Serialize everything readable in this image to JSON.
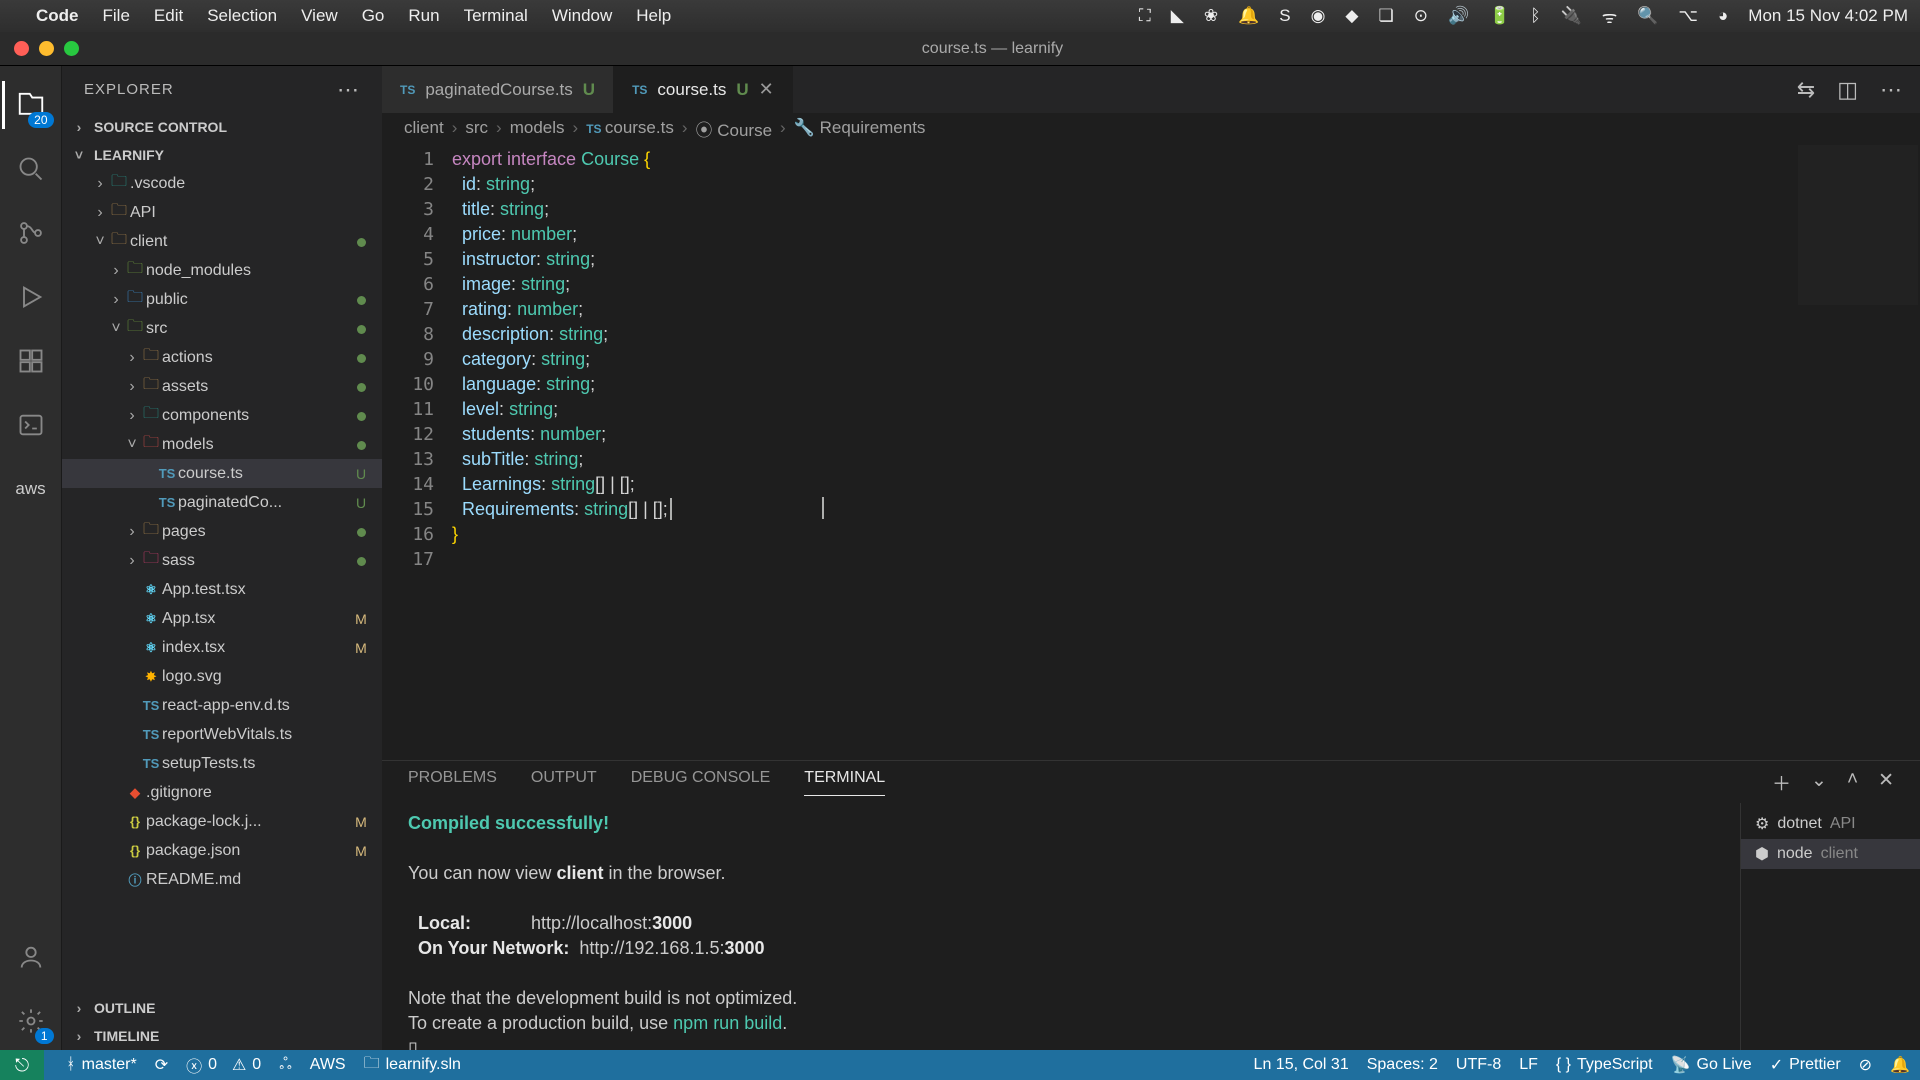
{
  "mac": {
    "app": "Code",
    "menus": [
      "File",
      "Edit",
      "Selection",
      "View",
      "Go",
      "Run",
      "Terminal",
      "Window",
      "Help"
    ],
    "clock": "Mon 15 Nov  4:02 PM"
  },
  "window": {
    "title": "course.ts — learnify"
  },
  "activity": {
    "badge_explorer": "20",
    "badge_settings": "1",
    "aws": "aws"
  },
  "explorer": {
    "title": "EXPLORER",
    "sections": {
      "source_control": "SOURCE CONTROL",
      "project": "LEARNIFY",
      "outline": "OUTLINE",
      "timeline": "TIMELINE"
    },
    "tree": [
      {
        "d": 2,
        "t": "folder",
        "icon": "folder-teal",
        "name": ".vscode",
        "chev": "›"
      },
      {
        "d": 2,
        "t": "folder",
        "icon": "folder-ico",
        "name": "API",
        "chev": "›"
      },
      {
        "d": 2,
        "t": "folder",
        "icon": "folder-ico",
        "name": "client",
        "chev": "˅",
        "dot": true
      },
      {
        "d": 3,
        "t": "folder",
        "icon": "folder-green",
        "name": "node_modules",
        "chev": "›"
      },
      {
        "d": 3,
        "t": "folder",
        "icon": "folder-blue",
        "name": "public",
        "chev": "›",
        "dot": true
      },
      {
        "d": 3,
        "t": "folder",
        "icon": "folder-green",
        "name": "src",
        "chev": "˅",
        "dot": true
      },
      {
        "d": 4,
        "t": "folder",
        "icon": "folder-ico",
        "name": "actions",
        "chev": "›",
        "dot": true
      },
      {
        "d": 4,
        "t": "folder",
        "icon": "folder-ico",
        "name": "assets",
        "chev": "›",
        "dot": true
      },
      {
        "d": 4,
        "t": "folder",
        "icon": "folder-teal",
        "name": "components",
        "chev": "›",
        "dot": true
      },
      {
        "d": 4,
        "t": "folder",
        "icon": "folder-red",
        "name": "models",
        "chev": "˅",
        "dot": true
      },
      {
        "d": 5,
        "t": "file",
        "icon": "ts-ico",
        "name": "course.ts",
        "status": "U",
        "sel": true
      },
      {
        "d": 5,
        "t": "file",
        "icon": "ts-ico",
        "name": "paginatedCo...",
        "status": "U"
      },
      {
        "d": 4,
        "t": "folder",
        "icon": "folder-ico",
        "name": "pages",
        "chev": "›",
        "dot": true
      },
      {
        "d": 4,
        "t": "folder",
        "icon": "folder-pink",
        "name": "sass",
        "chev": "›",
        "dot": true
      },
      {
        "d": 4,
        "t": "file",
        "icon": "react-ico",
        "name": "App.test.tsx"
      },
      {
        "d": 4,
        "t": "file",
        "icon": "react-ico",
        "name": "App.tsx",
        "status": "M"
      },
      {
        "d": 4,
        "t": "file",
        "icon": "react-ico",
        "name": "index.tsx",
        "status": "M"
      },
      {
        "d": 4,
        "t": "file",
        "icon": "svg-ico",
        "name": "logo.svg"
      },
      {
        "d": 4,
        "t": "file",
        "icon": "ts-ico",
        "name": "react-app-env.d.ts"
      },
      {
        "d": 4,
        "t": "file",
        "icon": "ts-ico",
        "name": "reportWebVitals.ts"
      },
      {
        "d": 4,
        "t": "file",
        "icon": "ts-ico",
        "name": "setupTests.ts"
      },
      {
        "d": 3,
        "t": "file",
        "icon": "git-ico",
        "name": ".gitignore"
      },
      {
        "d": 3,
        "t": "file",
        "icon": "json-ico",
        "name": "package-lock.j...",
        "status": "M"
      },
      {
        "d": 3,
        "t": "file",
        "icon": "json-ico",
        "name": "package.json",
        "status": "M"
      },
      {
        "d": 3,
        "t": "file",
        "icon": "md-ico",
        "name": "README.md"
      }
    ]
  },
  "tabs": [
    {
      "name": "paginatedCourse.ts",
      "mod": "U",
      "active": false
    },
    {
      "name": "course.ts",
      "mod": "U",
      "active": true
    }
  ],
  "breadcrumb": [
    "client",
    "src",
    "models",
    "course.ts",
    "Course",
    "Requirements"
  ],
  "code": {
    "lines": 17,
    "src": [
      {
        "n": 1,
        "t": [
          [
            "kw",
            "export "
          ],
          [
            "kw",
            "interface "
          ],
          [
            "typename",
            "Course "
          ],
          [
            "brace",
            "{"
          ]
        ]
      },
      {
        "n": 2,
        "t": [
          [
            "punc",
            "  "
          ],
          [
            "ident",
            "id"
          ],
          [
            "punc",
            ": "
          ],
          [
            "type",
            "string"
          ],
          [
            "punc",
            ";"
          ]
        ]
      },
      {
        "n": 3,
        "t": [
          [
            "punc",
            "  "
          ],
          [
            "ident",
            "title"
          ],
          [
            "punc",
            ": "
          ],
          [
            "type",
            "string"
          ],
          [
            "punc",
            ";"
          ]
        ]
      },
      {
        "n": 4,
        "t": [
          [
            "punc",
            "  "
          ],
          [
            "ident",
            "price"
          ],
          [
            "punc",
            ": "
          ],
          [
            "type",
            "number"
          ],
          [
            "punc",
            ";"
          ]
        ]
      },
      {
        "n": 5,
        "t": [
          [
            "punc",
            "  "
          ],
          [
            "ident",
            "instructor"
          ],
          [
            "punc",
            ": "
          ],
          [
            "type",
            "string"
          ],
          [
            "punc",
            ";"
          ]
        ]
      },
      {
        "n": 6,
        "t": [
          [
            "punc",
            "  "
          ],
          [
            "ident",
            "image"
          ],
          [
            "punc",
            ": "
          ],
          [
            "type",
            "string"
          ],
          [
            "punc",
            ";"
          ]
        ]
      },
      {
        "n": 7,
        "t": [
          [
            "punc",
            "  "
          ],
          [
            "ident",
            "rating"
          ],
          [
            "punc",
            ": "
          ],
          [
            "type",
            "number"
          ],
          [
            "punc",
            ";"
          ]
        ]
      },
      {
        "n": 8,
        "t": [
          [
            "punc",
            "  "
          ],
          [
            "ident",
            "description"
          ],
          [
            "punc",
            ": "
          ],
          [
            "type",
            "string"
          ],
          [
            "punc",
            ";"
          ]
        ]
      },
      {
        "n": 9,
        "t": [
          [
            "punc",
            "  "
          ],
          [
            "ident",
            "category"
          ],
          [
            "punc",
            ": "
          ],
          [
            "type",
            "string"
          ],
          [
            "punc",
            ";"
          ]
        ]
      },
      {
        "n": 10,
        "t": [
          [
            "punc",
            "  "
          ],
          [
            "ident",
            "language"
          ],
          [
            "punc",
            ": "
          ],
          [
            "type",
            "string"
          ],
          [
            "punc",
            ";"
          ]
        ]
      },
      {
        "n": 11,
        "t": [
          [
            "punc",
            "  "
          ],
          [
            "ident",
            "level"
          ],
          [
            "punc",
            ": "
          ],
          [
            "type",
            "string"
          ],
          [
            "punc",
            ";"
          ]
        ]
      },
      {
        "n": 12,
        "t": [
          [
            "punc",
            "  "
          ],
          [
            "ident",
            "students"
          ],
          [
            "punc",
            ": "
          ],
          [
            "type",
            "number"
          ],
          [
            "punc",
            ";"
          ]
        ]
      },
      {
        "n": 13,
        "t": [
          [
            "punc",
            "  "
          ],
          [
            "ident",
            "subTitle"
          ],
          [
            "punc",
            ": "
          ],
          [
            "type",
            "string"
          ],
          [
            "punc",
            ";"
          ]
        ]
      },
      {
        "n": 14,
        "t": [
          [
            "punc",
            "  "
          ],
          [
            "ident",
            "Learnings"
          ],
          [
            "punc",
            ": "
          ],
          [
            "type",
            "string"
          ],
          [
            "punc",
            "[] | [];"
          ]
        ]
      },
      {
        "n": 15,
        "t": [
          [
            "punc",
            "  "
          ],
          [
            "ident",
            "Requirements"
          ],
          [
            "punc",
            ": "
          ],
          [
            "type",
            "string"
          ],
          [
            "punc",
            "[] | [];"
          ]
        ]
      },
      {
        "n": 16,
        "t": [
          [
            "brace",
            "}"
          ]
        ]
      },
      {
        "n": 17,
        "t": [
          [
            "punc",
            ""
          ]
        ]
      }
    ]
  },
  "panel": {
    "tabs": [
      "PROBLEMS",
      "OUTPUT",
      "DEBUG CONSOLE",
      "TERMINAL"
    ],
    "active": 3,
    "procs": [
      {
        "icon": "⚙",
        "name": "dotnet",
        "extra": "API"
      },
      {
        "icon": "⬢",
        "name": "node",
        "extra": "client",
        "active": true
      }
    ],
    "out": {
      "l1": "Compiled successfully!",
      "l2": "You can now view ",
      "l2b": "client",
      "l2c": " in the browser.",
      "l3a": "  Local:            ",
      "l3b": "http://localhost:",
      "l3c": "3000",
      "l4a": "  On Your Network:  ",
      "l4b": "http://192.168.1.5:",
      "l4c": "3000",
      "l5": "Note that the development build is not optimized.",
      "l6a": "To create a production build, use ",
      "l6b": "npm run build",
      "l6c": ".",
      "prompt": "▯"
    }
  },
  "status": {
    "branch": "master*",
    "errors": "0",
    "warnings": "0",
    "aws": "AWS",
    "sln": "learnify.sln",
    "pos": "Ln 15, Col 31",
    "spaces": "Spaces: 2",
    "enc": "UTF-8",
    "eol": "LF",
    "lang": "TypeScript",
    "golive": "Go Live",
    "prettier": "Prettier"
  }
}
